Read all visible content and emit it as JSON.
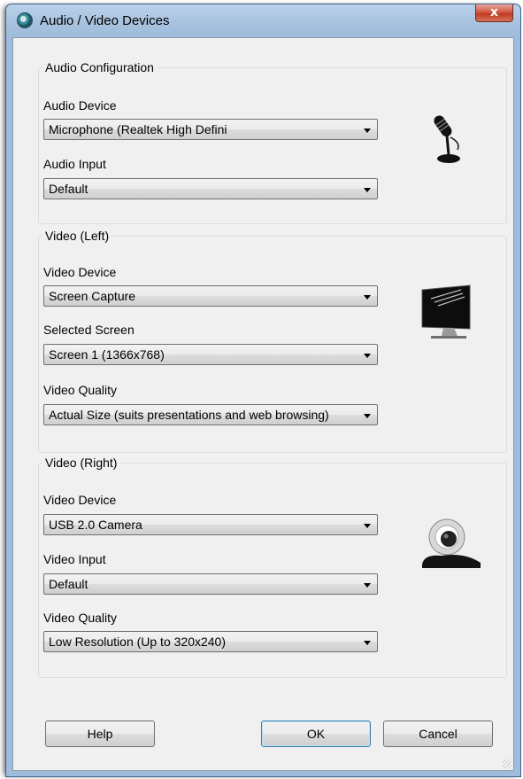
{
  "window": {
    "title": "Audio / Video Devices",
    "close_label": "x"
  },
  "audio": {
    "group_title": "Audio Configuration",
    "device_label": "Audio Device",
    "device_value": "Microphone (Realtek High Defini",
    "input_label": "Audio Input",
    "input_value": "Default",
    "icon": "microphone-icon"
  },
  "video_left": {
    "group_title": "Video (Left)",
    "device_label": "Video Device",
    "device_value": "Screen Capture",
    "screen_label": "Selected Screen",
    "screen_value": "Screen 1 (1366x768)",
    "quality_label": "Video Quality",
    "quality_value": "Actual Size (suits presentations and web browsing)",
    "icon": "monitor-icon"
  },
  "video_right": {
    "group_title": "Video (Right)",
    "device_label": "Video Device",
    "device_value": "USB 2.0 Camera",
    "input_label": "Video Input",
    "input_value": "Default",
    "quality_label": "Video Quality",
    "quality_value": "Low Resolution (Up to 320x240)",
    "icon": "webcam-icon"
  },
  "buttons": {
    "help": "Help",
    "ok": "OK",
    "cancel": "Cancel"
  }
}
